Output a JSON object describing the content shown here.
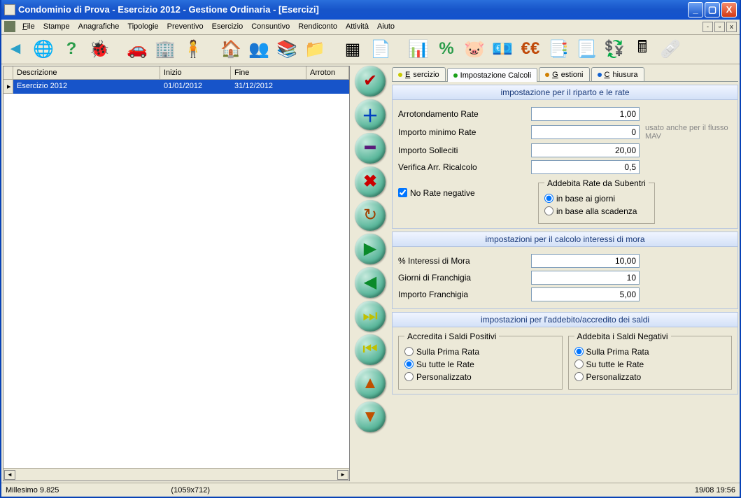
{
  "window": {
    "title": "Condominio di Prova - Esercizio 2012 - Gestione Ordinaria - [Esercizi]"
  },
  "menu": [
    "File",
    "Stampe",
    "Anagrafiche",
    "Tipologie",
    "Preventivo",
    "Esercizio",
    "Consuntivo",
    "Rendiconto",
    "Attività",
    "Aiuto"
  ],
  "grid": {
    "headers": [
      "Descrizione",
      "Inizio",
      "Fine",
      "Arroton"
    ],
    "row": {
      "desc": "Esercizio 2012",
      "inizio": "01/01/2012",
      "fine": "31/12/2012"
    }
  },
  "tabs": {
    "t1": "Esercizio",
    "t2": "Impostazione Calcoli",
    "t3": "Gestioni",
    "t4": "Chiusura"
  },
  "section1": {
    "title": "impostazione per il riparto e le rate",
    "f1_label": "Arrotondamento Rate",
    "f1_value": "1,00",
    "f2_label": "Importo minimo Rate",
    "f2_value": "0",
    "f2_hint": "usato anche per il flusso MAV",
    "f3_label": "Importo Solleciti",
    "f3_value": "20,00",
    "f4_label": "Verifica Arr. Ricalcolo",
    "f4_value": "0,5",
    "chk_label": "No Rate negative",
    "fs_legend": "Addebita Rate da Subentri",
    "r1": "in base ai giorni",
    "r2": "in base alla scadenza"
  },
  "section2": {
    "title": "impostazioni per il calcolo interessi di mora",
    "f1_label": "% Interessi di Mora",
    "f1_value": "10,00",
    "f2_label": "Giorni di Franchigia",
    "f2_value": "10",
    "f3_label": "Importo Franchigia",
    "f3_value": "5,00"
  },
  "section3": {
    "title": "impostazioni per l'addebito/accredito dei saldi",
    "left_legend": "Accredita i Saldi Positivi",
    "right_legend": "Addebita i Saldi Negativi",
    "o1": "Sulla Prima Rata",
    "o2": "Su tutte le Rate",
    "o3": "Personalizzato"
  },
  "status": {
    "left": "Millesimo 9.825",
    "mid": "(1059x712)",
    "right": "19/08 19:56"
  }
}
